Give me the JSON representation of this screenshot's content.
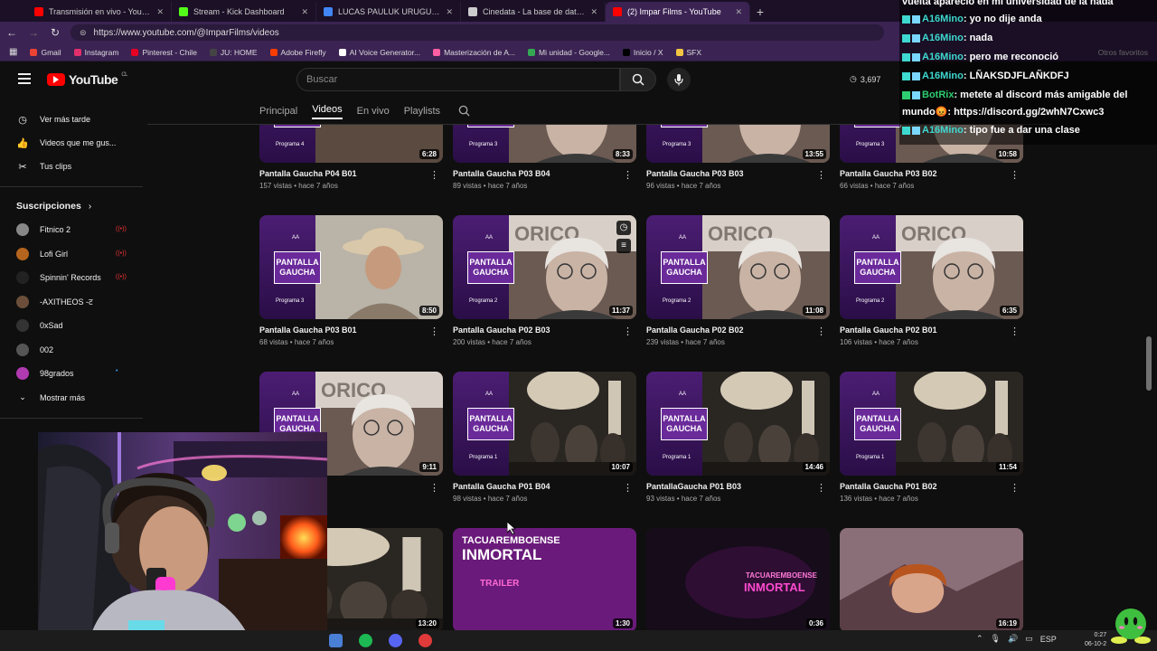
{
  "browser": {
    "tabs": [
      {
        "title": "Transmisión en vivo - YouTube St",
        "color": "#ff0000",
        "active": false
      },
      {
        "title": "Stream - Kick Dashboard",
        "color": "#53fc18",
        "active": false
      },
      {
        "title": "LUCAS PAULUK URUGUAY - Busc",
        "color": "#4285f4",
        "active": false
      },
      {
        "title": "Cinedata - La base de datos del",
        "color": "#cccccc",
        "active": false
      },
      {
        "title": "(2) Impar Films - YouTube",
        "color": "#ff0000",
        "active": true
      }
    ],
    "url": "https://www.youtube.com/@ImparFilms/videos",
    "bookmarks": [
      {
        "label": "Gmail",
        "color": "#ea4335"
      },
      {
        "label": "Instagram",
        "color": "#e1306c"
      },
      {
        "label": "Pinterest - Chile",
        "color": "#e60023"
      },
      {
        "label": "JU: HOME",
        "color": "#444444"
      },
      {
        "label": "Adobe Firefly",
        "color": "#ff3d00"
      },
      {
        "label": "AI Voice Generator...",
        "color": "#ffffff"
      },
      {
        "label": "Masterización de A...",
        "color": "#ff5fa2"
      },
      {
        "label": "Mi unidad - Google...",
        "color": "#34a853"
      },
      {
        "label": "Inicio / X",
        "color": "#000000"
      },
      {
        "label": "SFX",
        "color": "#f4c542"
      }
    ],
    "bookmarks_right": "Otros favoritos"
  },
  "youtube": {
    "logo_text": "YouTube",
    "logo_region": "CL",
    "search_placeholder": "Buscar",
    "viewer_count": "3,697",
    "channel_tabs": [
      "Principal",
      "Videos",
      "En vivo",
      "Playlists"
    ]
  },
  "sidebar": {
    "items": [
      {
        "label": "Ver más tarde",
        "icon": "clock-icon"
      },
      {
        "label": "Videos que me gus...",
        "icon": "thumbs-up-icon"
      },
      {
        "label": "Tus clips",
        "icon": "scissors-icon"
      }
    ],
    "subscriptions_title": "Suscripciones",
    "subscriptions": [
      {
        "label": "Fitnico 2",
        "live": true,
        "color": "#888"
      },
      {
        "label": "Lofi Girl",
        "live": true,
        "color": "#b5651d"
      },
      {
        "label": "Spinnin' Records",
        "live": true,
        "color": "#222"
      },
      {
        "label": "-AXITHEOS -ट",
        "live": false,
        "color": "#6b4f3a"
      },
      {
        "label": "0xSad",
        "live": false,
        "color": "#333"
      },
      {
        "label": "002",
        "live": false,
        "color": "#555"
      },
      {
        "label": "98grados",
        "live": false,
        "color": "#b03ab0",
        "new": true
      }
    ],
    "show_more": "Mostrar más"
  },
  "videos": [
    {
      "title": "Pantalla Gaucha P04 B01",
      "meta": "157 vistas • hace 7 años",
      "duration": "6:28",
      "program": "Programa 4",
      "scene": "food"
    },
    {
      "title": "Pantalla Gaucha P03 B04",
      "meta": "89 vistas • hace 7 años",
      "duration": "8:33",
      "program": "Programa 3",
      "scene": "woman"
    },
    {
      "title": "Pantalla Gaucha P03 B03",
      "meta": "96 vistas • hace 7 años",
      "duration": "13:55",
      "program": "Programa 3",
      "scene": "woman"
    },
    {
      "title": "Pantalla Gaucha P03 B02",
      "meta": "66 vistas • hace 7 años",
      "duration": "10:58",
      "program": "Programa 3",
      "scene": "woman"
    },
    {
      "title": "Pantalla Gaucha P03 B01",
      "meta": "68 vistas • hace 7 años",
      "duration": "8:50",
      "program": "Programa 3",
      "scene": "hat"
    },
    {
      "title": "Pantalla Gaucha P02 B03",
      "meta": "200 vistas • hace 7 años",
      "duration": "11:37",
      "program": "Programa 2",
      "scene": "oldlady"
    },
    {
      "title": "Pantalla Gaucha P02 B02",
      "meta": "239 vistas • hace 7 años",
      "duration": "11:08",
      "program": "Programa 2",
      "scene": "oldlady"
    },
    {
      "title": "Pantalla Gaucha P02 B01",
      "meta": "106 vistas • hace 7 años",
      "duration": "6:35",
      "program": "Programa 2",
      "scene": "oldlady"
    },
    {
      "title": "P02 B04",
      "meta": "os",
      "duration": "9:11",
      "program": "",
      "scene": "oldlady"
    },
    {
      "title": "Pantalla Gaucha P01 B04",
      "meta": "98 vistas • hace 7 años",
      "duration": "10:07",
      "program": "Programa 1",
      "scene": "crowd"
    },
    {
      "title": "PantallaGaucha P01 B03",
      "meta": "93 vistas • hace 7 años",
      "duration": "14:46",
      "program": "Programa 1",
      "scene": "crowd"
    },
    {
      "title": "Pantalla Gaucha P01 B02",
      "meta": "136 vistas • hace 7 años",
      "duration": "11:54",
      "program": "Programa 1",
      "scene": "crowd"
    },
    {
      "title": "",
      "meta": "",
      "duration": "13:20",
      "program": "",
      "scene": "crowd2"
    },
    {
      "title": "",
      "meta": "",
      "duration": "1:30",
      "program": "",
      "scene": "trailer",
      "overlay_a": "TACUAREMBOENSE",
      "overlay_b": "INMORTAL",
      "overlay_c": "TRAILER"
    },
    {
      "title": "",
      "meta": "",
      "duration": "0:36",
      "program": "",
      "scene": "dark",
      "overlay_a": "TACUAREMBOENSE",
      "overlay_b": "INMORTAL"
    },
    {
      "title": "",
      "meta": "",
      "duration": "16:19",
      "program": "",
      "scene": "portrait"
    }
  ],
  "thumb_badge": "PANTALLA GAUCHA",
  "thumb_logo": "AA",
  "chat": [
    {
      "user": "",
      "text": "vuelta apareció en mi universidad de la nada",
      "type": "partial"
    },
    {
      "user": "A16Mino",
      "text": ": yo no dije anda"
    },
    {
      "user": "A16Mino",
      "text": ": nada"
    },
    {
      "user": "A16Mino",
      "text": ": pero me reconoció"
    },
    {
      "user": "A16Mino",
      "text": ": LÑAKSDJFLAÑKDFJ"
    },
    {
      "user": "BotRix",
      "text": ": metete al discord más amigable del",
      "bot": true
    },
    {
      "user": "",
      "text": "mundo😡: https://discord.gg/2whN7Cxwc3",
      "type": "cont"
    },
    {
      "user": "A16Mino",
      "text": ": tipo fue a dar una clase"
    }
  ],
  "taskbar": {
    "lang": "ESP",
    "time": "0:27",
    "date": "06-10-2"
  }
}
